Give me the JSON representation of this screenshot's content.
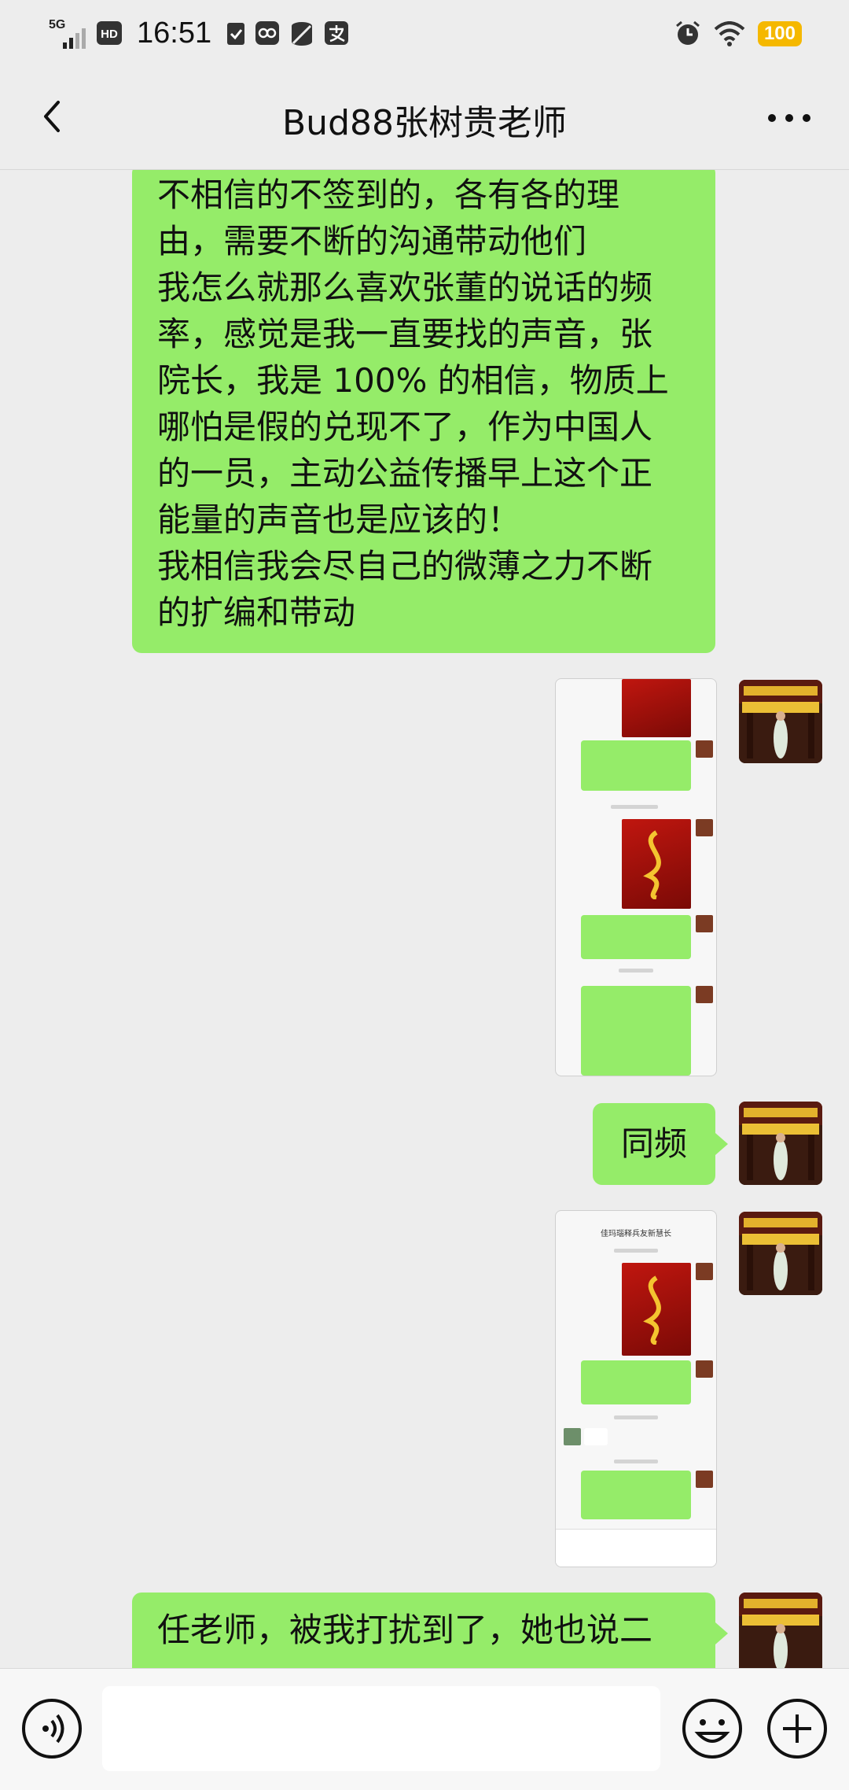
{
  "status_bar": {
    "network": "5G",
    "hd": "HD",
    "time": "16:51",
    "battery": "100",
    "icons": [
      "signal-icon",
      "hd-icon",
      "notification-check-icon",
      "app-icon",
      "data-saver-icon",
      "alipay-icon",
      "alarm-icon",
      "wifi-icon",
      "battery-icon"
    ]
  },
  "nav": {
    "title": "Bud88张树贵老师",
    "back_icon": "chevron-left-icon",
    "more_icon": "more-icon"
  },
  "messages": [
    {
      "type": "text",
      "lines": [
        "不相信的不签到的，各有各的理",
        "由，需要不断的沟通带动他们",
        "我怎么就那么喜欢张董的说话的频",
        "率，感觉是我一直要找的声音，张",
        "院长，我是 100% 的相信，物质上",
        "哪怕是假的兑现不了，作为中国人",
        "的一员，主动公益传播早上这个正",
        "能量的声音也是应该的！",
        "我相信我会尽自己的微薄之力不断",
        "的扩编和带动"
      ]
    },
    {
      "type": "image",
      "description_icon": "chat-screenshot-image"
    },
    {
      "type": "text",
      "lines": [
        "同频"
      ]
    },
    {
      "type": "image",
      "inner_title": "佳玛瑙释兵友新慧长"
    },
    {
      "type": "text",
      "lines": [
        "任老师，被我打扰到了，她也说二"
      ]
    }
  ],
  "input_bar": {
    "placeholder": "",
    "voice_icon": "voice-icon",
    "emoji_icon": "emoji-icon",
    "plus_icon": "plus-icon"
  },
  "colors": {
    "sent_bubble": "#95ec69",
    "background": "#ededed",
    "battery": "#f5b800"
  }
}
